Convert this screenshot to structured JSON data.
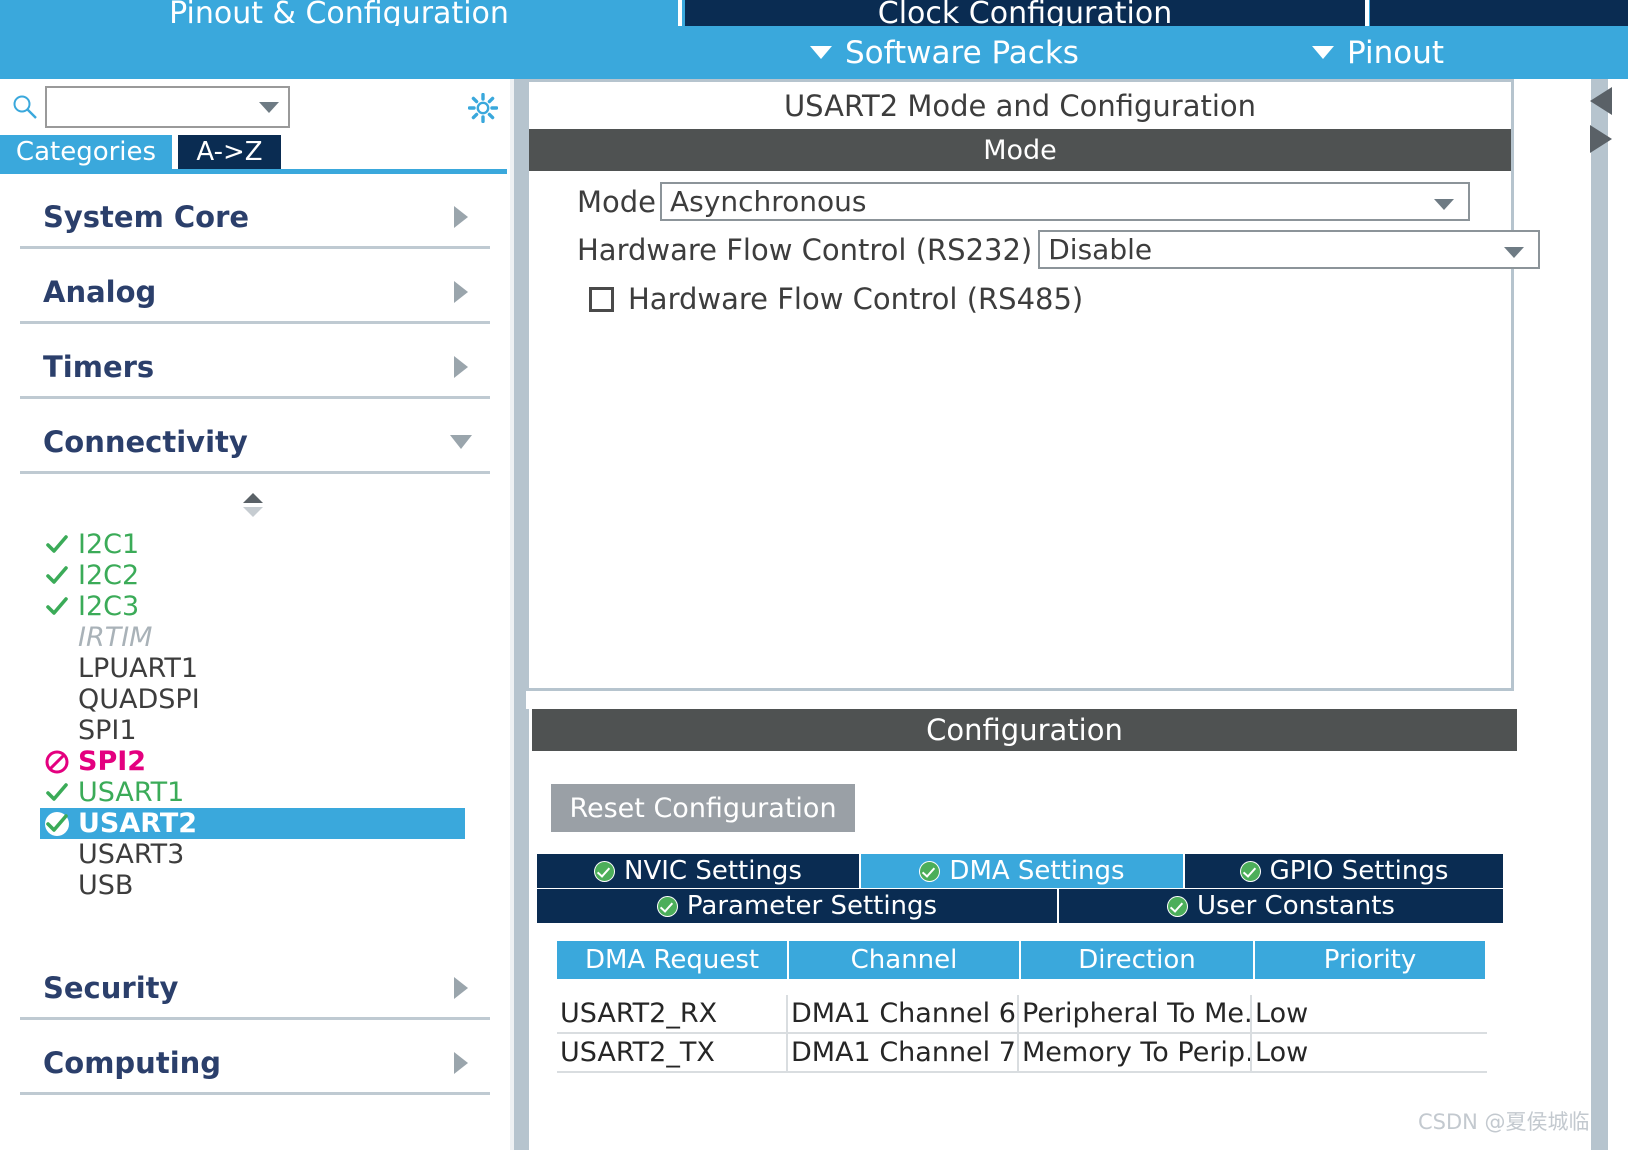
{
  "window": {
    "main_tabs": [
      {
        "label": "Pinout & Configuration",
        "selected": true
      },
      {
        "label": "Clock Configuration",
        "selected": false
      },
      {
        "label": "",
        "selected": false
      }
    ],
    "toolbar": [
      {
        "label": "Software Packs",
        "icon": "chevron-down-icon"
      },
      {
        "label": "Pinout",
        "icon": "chevron-down-icon"
      }
    ]
  },
  "sidebar": {
    "search": {
      "value": "",
      "placeholder": "",
      "icon": "search-icon"
    },
    "options_icon": "gear-icon",
    "view_tabs": [
      {
        "label": "Categories",
        "selected": true
      },
      {
        "label": "A->Z",
        "selected": false
      }
    ],
    "categories": [
      {
        "label": "System Core",
        "expanded": false,
        "icon": "chevron-right-icon"
      },
      {
        "label": "Analog",
        "expanded": false,
        "icon": "chevron-right-icon"
      },
      {
        "label": "Timers",
        "expanded": false,
        "icon": "chevron-right-icon"
      },
      {
        "label": "Connectivity",
        "expanded": true,
        "icon": "chevron-down-icon"
      }
    ],
    "categories_bottom": [
      {
        "label": "Security",
        "expanded": false,
        "icon": "chevron-right-icon"
      },
      {
        "label": "Computing",
        "expanded": false,
        "icon": "chevron-right-icon"
      }
    ],
    "peripherals": [
      {
        "label": "I2C1",
        "state": "enabled",
        "icon": "check-icon"
      },
      {
        "label": "I2C2",
        "state": "enabled",
        "icon": "check-icon"
      },
      {
        "label": "I2C3",
        "state": "enabled",
        "icon": "check-icon"
      },
      {
        "label": "IRTIM",
        "state": "disabled",
        "icon": "none"
      },
      {
        "label": "LPUART1",
        "state": "plain",
        "icon": "none"
      },
      {
        "label": "QUADSPI",
        "state": "plain",
        "icon": "none"
      },
      {
        "label": "SPI1",
        "state": "plain",
        "icon": "none"
      },
      {
        "label": "SPI2",
        "state": "conflict",
        "icon": "no-entry-icon"
      },
      {
        "label": "USART1",
        "state": "enabled",
        "icon": "check-icon"
      },
      {
        "label": "USART2",
        "state": "selected",
        "icon": "check-circle-icon"
      },
      {
        "label": "USART3",
        "state": "plain",
        "icon": "none"
      },
      {
        "label": "USB",
        "state": "plain",
        "icon": "none"
      }
    ]
  },
  "mode_panel": {
    "title": "USART2 Mode and Configuration",
    "section_label": "Mode",
    "mode_label": "Mode",
    "mode_value": "Asynchronous",
    "hfc_rs232_label": "Hardware Flow Control (RS232)",
    "hfc_rs232_value": "Disable",
    "hfc_rs485_label": "Hardware Flow Control (RS485)",
    "hfc_rs485_checked": false
  },
  "configuration": {
    "section_label": "Configuration",
    "reset_label": "Reset Configuration",
    "tabs_row1": [
      {
        "label": "NVIC Settings",
        "selected": false,
        "icon": "check-circle-icon"
      },
      {
        "label": "DMA Settings",
        "selected": true,
        "icon": "check-circle-icon"
      },
      {
        "label": "GPIO Settings",
        "selected": false,
        "icon": "check-circle-icon"
      }
    ],
    "tabs_row2": [
      {
        "label": "Parameter Settings",
        "selected": false,
        "icon": "check-circle-icon"
      },
      {
        "label": "User Constants",
        "selected": false,
        "icon": "check-circle-icon"
      }
    ],
    "dma_table": {
      "columns": [
        "DMA Request",
        "Channel",
        "Direction",
        "Priority"
      ],
      "rows": [
        [
          "USART2_RX",
          "DMA1 Channel 6",
          "Peripheral To Me...",
          "Low"
        ],
        [
          "USART2_TX",
          "DMA1 Channel 7",
          "Memory To Perip...",
          "Low"
        ]
      ]
    }
  },
  "colors": {
    "accent_blue": "#3aa8dc",
    "navy": "#0a2c52",
    "band_grey": "#4f5252",
    "ok_green": "#3bab58",
    "conflict_pink": "#e4007f"
  },
  "watermark": "CSDN @夏侯城临"
}
